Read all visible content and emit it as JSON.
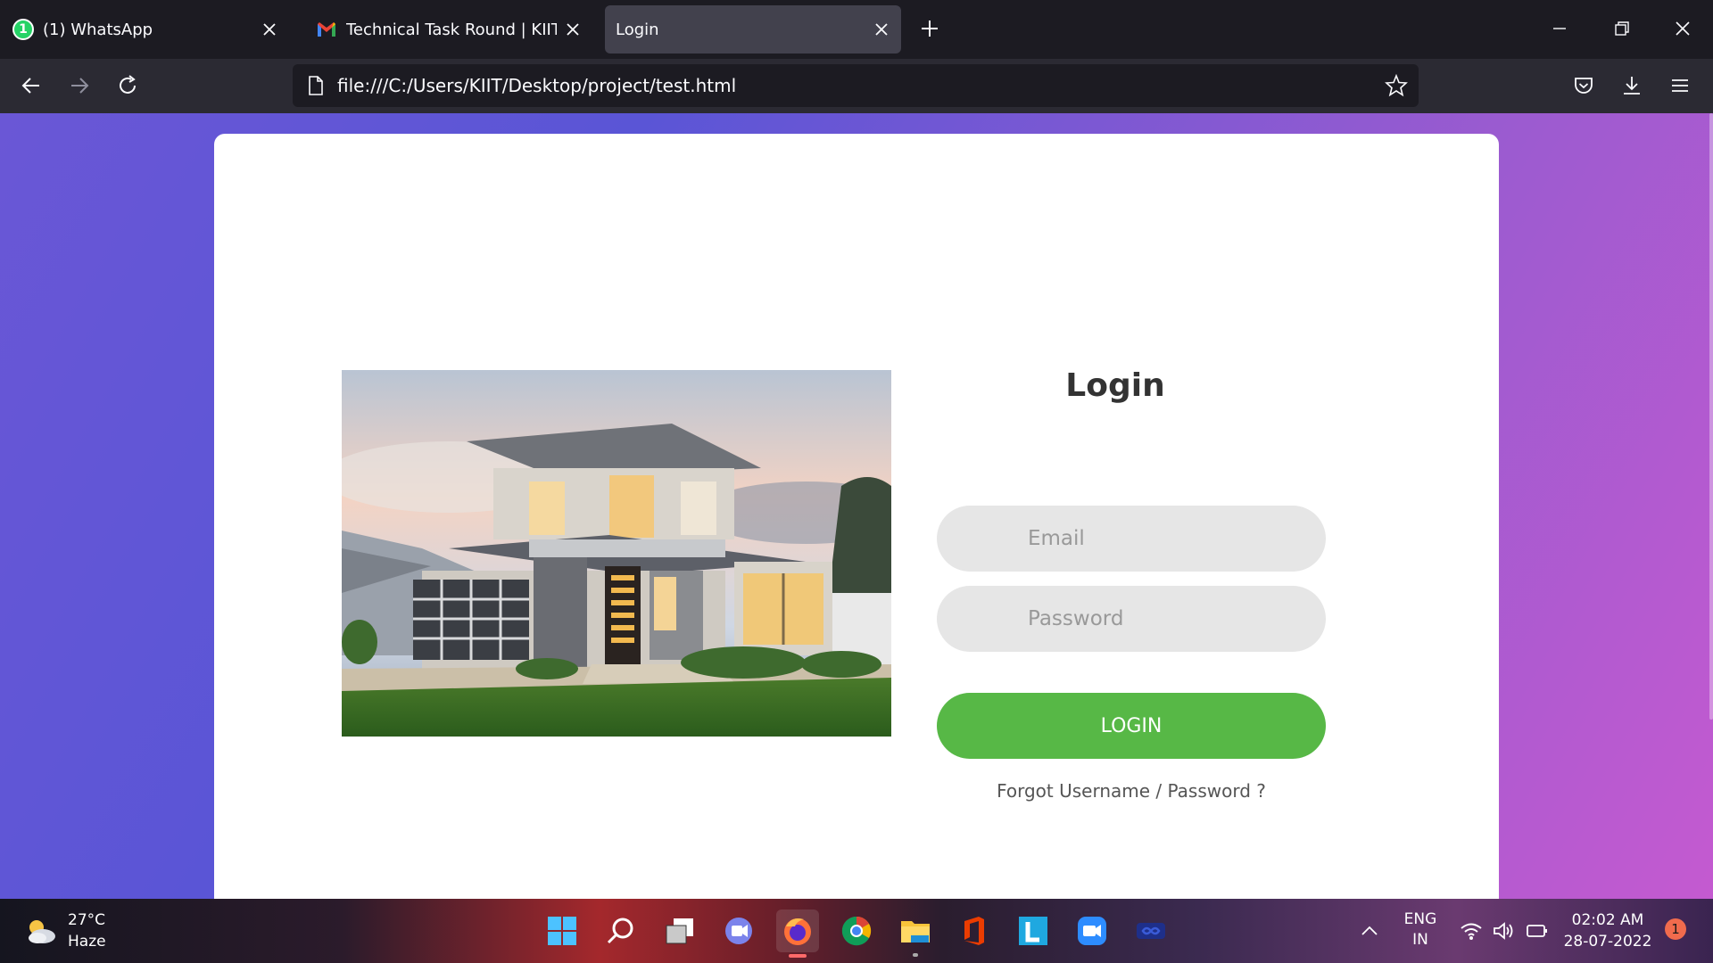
{
  "browser": {
    "tabs": [
      {
        "title": "(1) WhatsApp",
        "icon": "whatsapp-icon",
        "badge": "1",
        "active": false
      },
      {
        "title": "Technical Task Round | KIIT Univ",
        "icon": "gmail-icon",
        "active": false
      },
      {
        "title": "Login",
        "icon": "none",
        "active": true
      }
    ],
    "url": "file:///C:/Users/KIIT/Desktop/project/test.html"
  },
  "page": {
    "title": "Login",
    "email_placeholder": "Email",
    "password_placeholder": "Password",
    "login_button": "LOGIN",
    "forgot_link": "Forgot Username / Password ?",
    "image_alt": "modern two-storey house"
  },
  "taskbar": {
    "weather": {
      "temp": "27°C",
      "condition": "Haze"
    },
    "apps": [
      "start-icon",
      "search-icon",
      "task-view-icon",
      "chat-icon",
      "firefox-icon",
      "chrome-icon",
      "file-explorer-icon",
      "office-icon",
      "l-app-icon",
      "zoom-icon",
      "infinity-app-icon"
    ],
    "language": {
      "line1": "ENG",
      "line2": "IN"
    },
    "clock": {
      "time": "02:02 AM",
      "date": "28-07-2022"
    },
    "notification_count": "1"
  },
  "colors": {
    "accent_button": "#57b846",
    "gradient_start": "#5a55d6",
    "gradient_end": "#c45ad0"
  }
}
